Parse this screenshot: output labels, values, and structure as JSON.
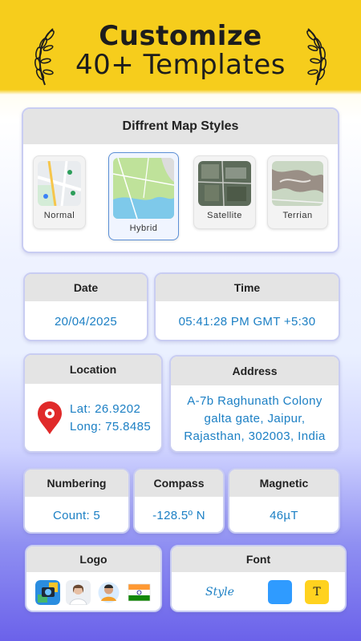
{
  "hero": {
    "line1": "Customize",
    "line2": "40+ Templates"
  },
  "map_styles": {
    "title": "Diffrent Map Styles",
    "items": [
      {
        "label": "Normal",
        "selected": false
      },
      {
        "label": "Hybrid",
        "selected": true
      },
      {
        "label": "Satellite",
        "selected": false
      },
      {
        "label": "Terrian",
        "selected": false
      }
    ]
  },
  "date": {
    "title": "Date",
    "value": "20/04/2025"
  },
  "time": {
    "title": "Time",
    "value": "05:41:28 PM GMT +5:30"
  },
  "location": {
    "title": "Location",
    "lat": "Lat: 26.9202",
    "long": "Long: 75.8485"
  },
  "address": {
    "title": "Address",
    "line1": "A-7b Raghunath Colony",
    "line2": "galta gate, Jaipur,",
    "line3": "Rajasthan, 302003, India"
  },
  "numbering": {
    "title": "Numbering",
    "value": "Count: 5"
  },
  "compass": {
    "title": "Compass",
    "value": "-128.5º N"
  },
  "magnetic": {
    "title": "Magnetic",
    "value": "46µT"
  },
  "logo": {
    "title": "Logo",
    "icons": [
      "camera-app-icon",
      "person-photo-icon",
      "user-avatar-icon",
      "india-flag-icon"
    ]
  },
  "font": {
    "title": "Font",
    "style_label": "Style",
    "swatch_letter": "T"
  },
  "colors": {
    "accent_text": "#1b7fc4",
    "hero_bg": "#f6cd1c",
    "selected_border": "#5b8fd6",
    "swatch_blue": "#2f9bff",
    "swatch_yellow": "#ffd21f",
    "pin_red": "#e02a2a"
  }
}
